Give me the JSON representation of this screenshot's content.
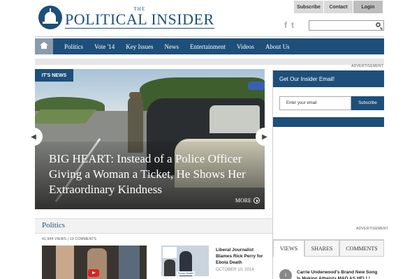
{
  "header": {
    "logo_the": "THE",
    "logo_main": "POLITICAL INSIDER",
    "top_links": [
      "Subscribe",
      "Contact",
      "Login"
    ],
    "social": [
      "f",
      "t"
    ]
  },
  "nav": {
    "items": [
      "Politics",
      "Vote '14",
      "Key Issues",
      "News",
      "Entertainment",
      "Videos",
      "About Us"
    ]
  },
  "ads": {
    "label": "ADVERTISEMENT"
  },
  "hero": {
    "tag": "IT'S NEWS",
    "headline": "BIG HEART: Instead of a Police Officer Giving a Woman a Ticket, He Shows Her Extraordinary Kindness",
    "more": "MORE"
  },
  "newsletter": {
    "title": "Get Our Insider Email!",
    "placeholder": "Enter your email",
    "button": "Subscribe"
  },
  "section": {
    "title": "Politics",
    "stats": "41,944 VIEWS | 19 COMMENTS",
    "thumb_logo": "Texas Health",
    "story2_title": "Liberal Journalist Blames Rick Perry for Ebola Death",
    "story2_date": "OCTOBER 10, 2014"
  },
  "tabs": {
    "items": [
      "VIEWS",
      "SHARES",
      "COMMENTS"
    ]
  },
  "popular": {
    "rank": "1",
    "title": "Carrie Underwood's Brand New Song Is Making Atheists MAD AS HELL!"
  },
  "colors": {
    "brand_blue": "#1d4f7a",
    "nav_home": "#8a9bac"
  }
}
